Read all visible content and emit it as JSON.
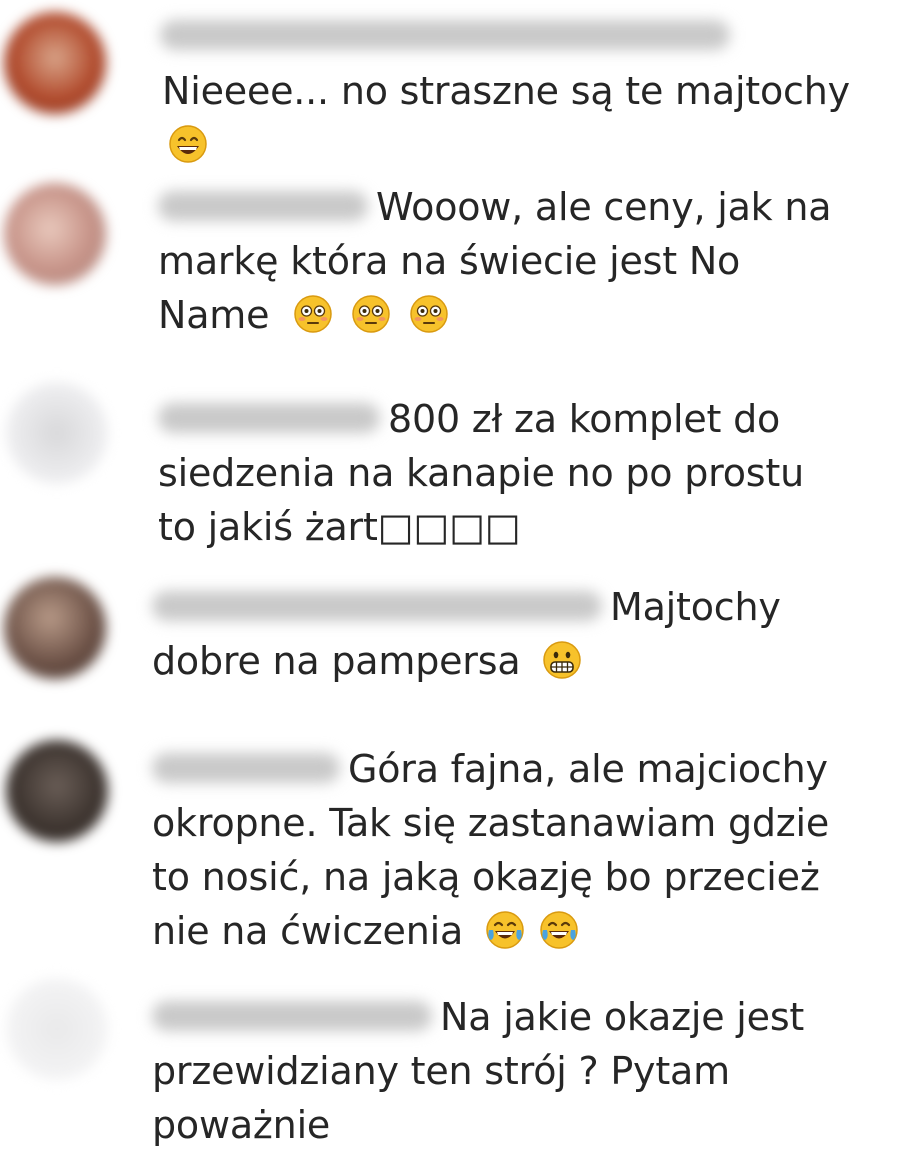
{
  "comments": [
    {
      "text_line1": "Nieeee... no straszne są te majtochy",
      "emoji_1": "grinning-smiling-eyes-icon"
    },
    {
      "text_line1": "Wooow, ale ceny, jak na",
      "text_line2": "markę która na świecie jest No",
      "text_line3": "Name",
      "emoji_1": "flushed-face-icon",
      "emoji_2": "flushed-face-icon",
      "emoji_3": "flushed-face-icon"
    },
    {
      "text_line1": "800 zł za komplet do",
      "text_line2": "siedzenia na kanapie no po prostu",
      "text_line3": "to jakiś żart□□□□"
    },
    {
      "text_line1": "Majtochy",
      "text_line2": "dobre na pampersa",
      "emoji_1": "grimacing-face-icon"
    },
    {
      "text_line1": "Góra fajna, ale majciochy",
      "text_line2": "okropne. Tak się zastanawiam gdzie",
      "text_line3": "to nosić, na jaką okazję bo przecież",
      "text_line4": "nie na ćwiczenia",
      "emoji_1": "tears-of-joy-icon",
      "emoji_2": "tears-of-joy-icon"
    },
    {
      "text_line1": "Na jakie okazje jest",
      "text_line2": "przewidziany ten strój ? Pytam",
      "text_line3": "poważnie"
    }
  ]
}
